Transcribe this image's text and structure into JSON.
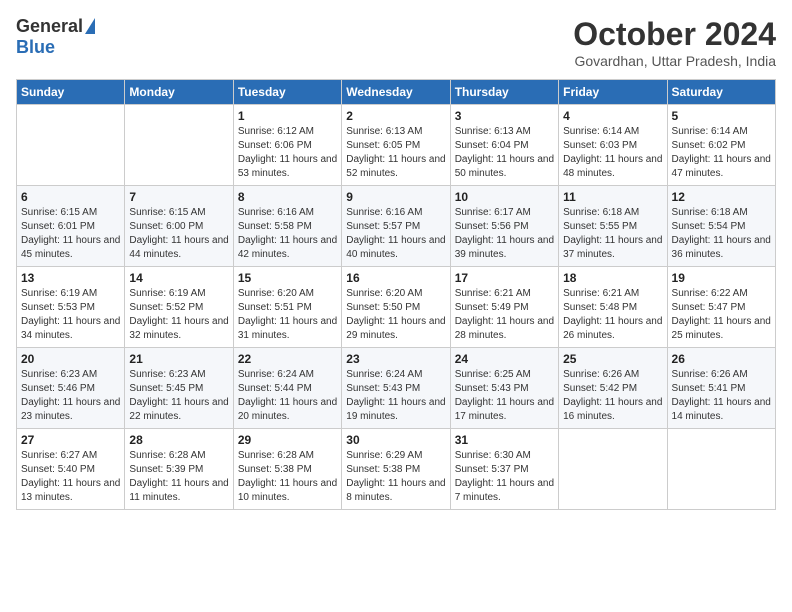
{
  "logo": {
    "general": "General",
    "blue": "Blue"
  },
  "title": "October 2024",
  "location": "Govardhan, Uttar Pradesh, India",
  "headers": [
    "Sunday",
    "Monday",
    "Tuesday",
    "Wednesday",
    "Thursday",
    "Friday",
    "Saturday"
  ],
  "weeks": [
    [
      {
        "day": "",
        "info": ""
      },
      {
        "day": "",
        "info": ""
      },
      {
        "day": "1",
        "info": "Sunrise: 6:12 AM\nSunset: 6:06 PM\nDaylight: 11 hours and 53 minutes."
      },
      {
        "day": "2",
        "info": "Sunrise: 6:13 AM\nSunset: 6:05 PM\nDaylight: 11 hours and 52 minutes."
      },
      {
        "day": "3",
        "info": "Sunrise: 6:13 AM\nSunset: 6:04 PM\nDaylight: 11 hours and 50 minutes."
      },
      {
        "day": "4",
        "info": "Sunrise: 6:14 AM\nSunset: 6:03 PM\nDaylight: 11 hours and 48 minutes."
      },
      {
        "day": "5",
        "info": "Sunrise: 6:14 AM\nSunset: 6:02 PM\nDaylight: 11 hours and 47 minutes."
      }
    ],
    [
      {
        "day": "6",
        "info": "Sunrise: 6:15 AM\nSunset: 6:01 PM\nDaylight: 11 hours and 45 minutes."
      },
      {
        "day": "7",
        "info": "Sunrise: 6:15 AM\nSunset: 6:00 PM\nDaylight: 11 hours and 44 minutes."
      },
      {
        "day": "8",
        "info": "Sunrise: 6:16 AM\nSunset: 5:58 PM\nDaylight: 11 hours and 42 minutes."
      },
      {
        "day": "9",
        "info": "Sunrise: 6:16 AM\nSunset: 5:57 PM\nDaylight: 11 hours and 40 minutes."
      },
      {
        "day": "10",
        "info": "Sunrise: 6:17 AM\nSunset: 5:56 PM\nDaylight: 11 hours and 39 minutes."
      },
      {
        "day": "11",
        "info": "Sunrise: 6:18 AM\nSunset: 5:55 PM\nDaylight: 11 hours and 37 minutes."
      },
      {
        "day": "12",
        "info": "Sunrise: 6:18 AM\nSunset: 5:54 PM\nDaylight: 11 hours and 36 minutes."
      }
    ],
    [
      {
        "day": "13",
        "info": "Sunrise: 6:19 AM\nSunset: 5:53 PM\nDaylight: 11 hours and 34 minutes."
      },
      {
        "day": "14",
        "info": "Sunrise: 6:19 AM\nSunset: 5:52 PM\nDaylight: 11 hours and 32 minutes."
      },
      {
        "day": "15",
        "info": "Sunrise: 6:20 AM\nSunset: 5:51 PM\nDaylight: 11 hours and 31 minutes."
      },
      {
        "day": "16",
        "info": "Sunrise: 6:20 AM\nSunset: 5:50 PM\nDaylight: 11 hours and 29 minutes."
      },
      {
        "day": "17",
        "info": "Sunrise: 6:21 AM\nSunset: 5:49 PM\nDaylight: 11 hours and 28 minutes."
      },
      {
        "day": "18",
        "info": "Sunrise: 6:21 AM\nSunset: 5:48 PM\nDaylight: 11 hours and 26 minutes."
      },
      {
        "day": "19",
        "info": "Sunrise: 6:22 AM\nSunset: 5:47 PM\nDaylight: 11 hours and 25 minutes."
      }
    ],
    [
      {
        "day": "20",
        "info": "Sunrise: 6:23 AM\nSunset: 5:46 PM\nDaylight: 11 hours and 23 minutes."
      },
      {
        "day": "21",
        "info": "Sunrise: 6:23 AM\nSunset: 5:45 PM\nDaylight: 11 hours and 22 minutes."
      },
      {
        "day": "22",
        "info": "Sunrise: 6:24 AM\nSunset: 5:44 PM\nDaylight: 11 hours and 20 minutes."
      },
      {
        "day": "23",
        "info": "Sunrise: 6:24 AM\nSunset: 5:43 PM\nDaylight: 11 hours and 19 minutes."
      },
      {
        "day": "24",
        "info": "Sunrise: 6:25 AM\nSunset: 5:43 PM\nDaylight: 11 hours and 17 minutes."
      },
      {
        "day": "25",
        "info": "Sunrise: 6:26 AM\nSunset: 5:42 PM\nDaylight: 11 hours and 16 minutes."
      },
      {
        "day": "26",
        "info": "Sunrise: 6:26 AM\nSunset: 5:41 PM\nDaylight: 11 hours and 14 minutes."
      }
    ],
    [
      {
        "day": "27",
        "info": "Sunrise: 6:27 AM\nSunset: 5:40 PM\nDaylight: 11 hours and 13 minutes."
      },
      {
        "day": "28",
        "info": "Sunrise: 6:28 AM\nSunset: 5:39 PM\nDaylight: 11 hours and 11 minutes."
      },
      {
        "day": "29",
        "info": "Sunrise: 6:28 AM\nSunset: 5:38 PM\nDaylight: 11 hours and 10 minutes."
      },
      {
        "day": "30",
        "info": "Sunrise: 6:29 AM\nSunset: 5:38 PM\nDaylight: 11 hours and 8 minutes."
      },
      {
        "day": "31",
        "info": "Sunrise: 6:30 AM\nSunset: 5:37 PM\nDaylight: 11 hours and 7 minutes."
      },
      {
        "day": "",
        "info": ""
      },
      {
        "day": "",
        "info": ""
      }
    ]
  ]
}
